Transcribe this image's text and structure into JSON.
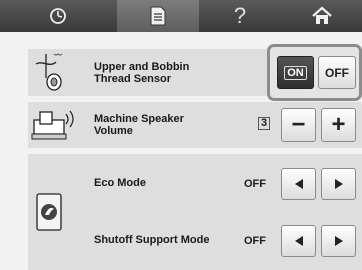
{
  "tabs": [
    {
      "icon": "sewing-machine-icon"
    },
    {
      "icon": "document-icon"
    },
    {
      "label": "?"
    },
    {
      "icon": "home-icon"
    }
  ],
  "settings": {
    "thread_sensor": {
      "label": "Upper and Bobbin\nThread Sensor",
      "on_label": "ON",
      "off_label": "OFF",
      "selected": "ON"
    },
    "speaker": {
      "label": "Machine Speaker\nVolume",
      "value": "3",
      "minus": "−",
      "plus": "+"
    },
    "eco": {
      "label": "Eco Mode",
      "value": "OFF"
    },
    "shutoff": {
      "label": "Shutoff Support Mode",
      "value": "OFF"
    }
  }
}
